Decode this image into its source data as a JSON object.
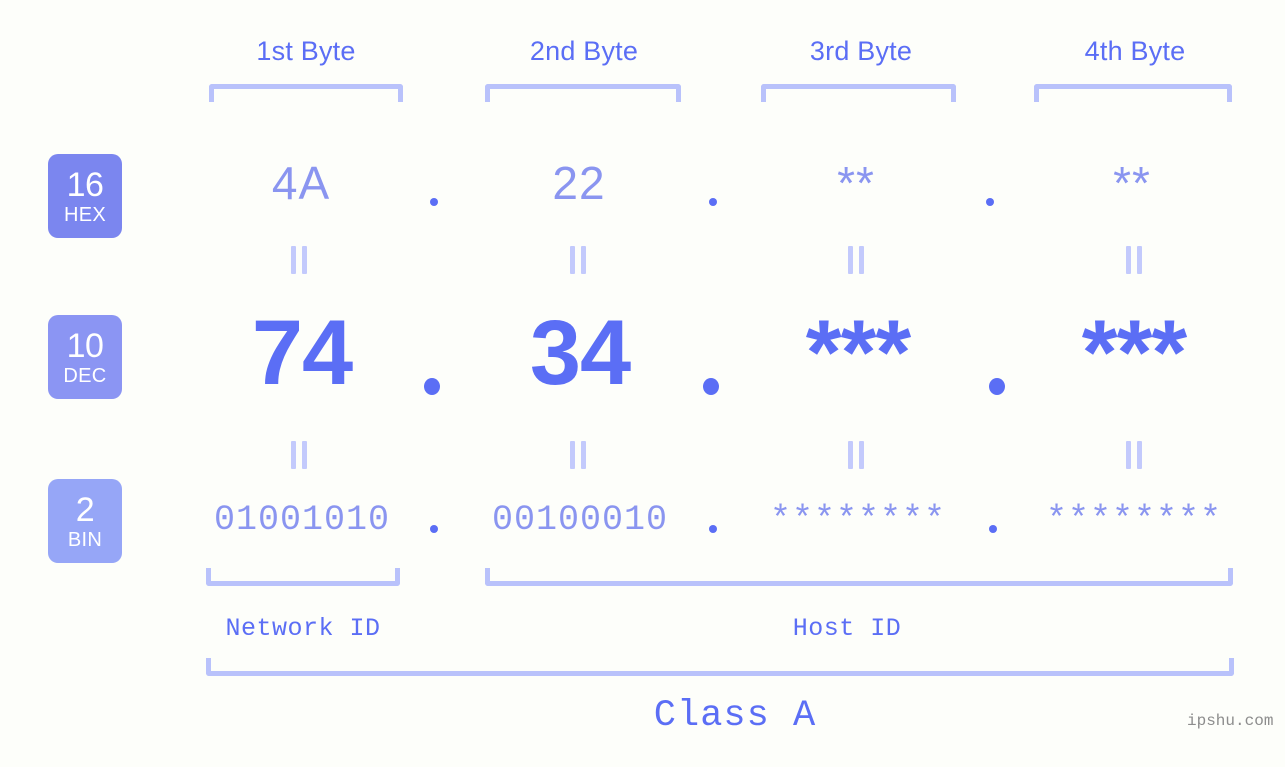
{
  "meta": {
    "watermark": "ipshu.com",
    "background_color": "#fdfefa",
    "accent_color": "#5b6ef5",
    "accent_light_color": "#8a95f0",
    "bracket_color": "#b9c2fb"
  },
  "byte_headers": [
    {
      "label": "1st Byte"
    },
    {
      "label": "2nd Byte"
    },
    {
      "label": "3rd Byte"
    },
    {
      "label": "4th Byte"
    }
  ],
  "bases": [
    {
      "number": "16",
      "name": "HEX",
      "color": "#7b86ef"
    },
    {
      "number": "10",
      "name": "DEC",
      "color": "#8b95f3"
    },
    {
      "number": "2",
      "name": "BIN",
      "color": "#96a6f7"
    }
  ],
  "rows": {
    "hex": {
      "base": "16",
      "name": "HEX",
      "values": [
        "4A",
        "22",
        "**",
        "**"
      ],
      "separator": "."
    },
    "dec": {
      "base": "10",
      "name": "DEC",
      "values": [
        "74",
        "34",
        "***",
        "***"
      ],
      "separator": "."
    },
    "bin": {
      "base": "2",
      "name": "BIN",
      "values": [
        "01001010",
        "00100010",
        "********",
        "********"
      ],
      "separator": "."
    }
  },
  "segments": {
    "network_id": "Network ID",
    "host_id": "Host ID",
    "class": "Class A"
  },
  "equality_marker": "||"
}
